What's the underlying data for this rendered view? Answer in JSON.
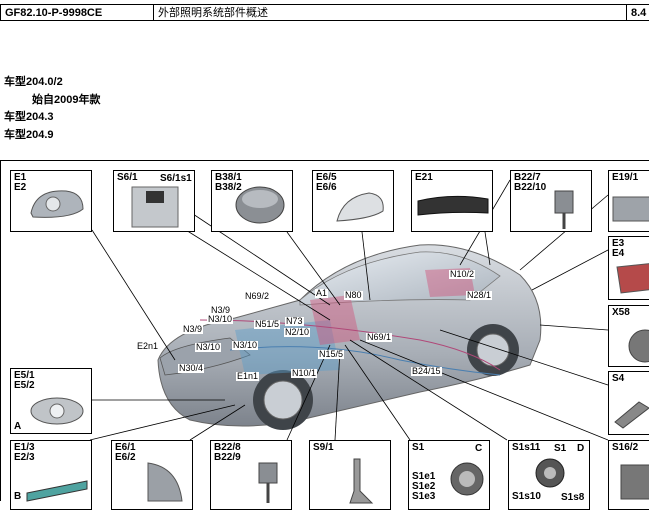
{
  "header": {
    "doc_code": "GF82.10-P-9998CE",
    "title": "外部照明系统部件概述",
    "page": "8.4"
  },
  "models": {
    "m1": "车型204.0/2",
    "m1_sub": "始自2009年款",
    "m2": "车型204.3",
    "m3": "车型204.9"
  },
  "boxes": {
    "e1": "E1\nE2",
    "s6": "S6/1",
    "s6b": "S6/1s1",
    "b38": "B38/1\nB38/2",
    "e6": "E6/5\nE6/6",
    "e21": "E21",
    "b22": "B22/7\nB22/10",
    "e19": "E19/1",
    "e3": "E3\nE4",
    "x58": "X58",
    "s4": "S4",
    "e5": "E5/1\nE5/2",
    "e5_letter": "A",
    "e13": "E1/3\nE2/3",
    "e13_letter": "B",
    "e6b": "E6/1\nE6/2",
    "b228": "B22/8\nB22/9",
    "s9": "S9/1",
    "s1": "S1",
    "s1_letter": "C",
    "s1_items": "S1e1\nS1e2\nS1e3",
    "s1s11": "S1s11",
    "s1d": "S1",
    "s1d_letter": "D",
    "s1s10": "S1s10",
    "s1s8": "S1s8",
    "s16": "S16/2"
  },
  "callouts": {
    "n10_2": "N10/2",
    "n28_1": "N28/1",
    "a1": "A1",
    "n80": "N80",
    "n69_2": "N69/2",
    "n3_9a": "N3/9",
    "n3_10a": "N3/10",
    "n73": "N73",
    "n51_5": "N51/5",
    "n2_10": "N2/10",
    "n3_9b": "N3/9",
    "n3_10b": "N3/10",
    "n3_10c": "N3/10",
    "e2n1": "E2n1",
    "n69_1": "N69/1",
    "n15_5": "N15/5",
    "n30_4": "N30/4",
    "e1n1": "E1n1",
    "n10_1": "N10/1",
    "b24_15": "B24/15"
  }
}
